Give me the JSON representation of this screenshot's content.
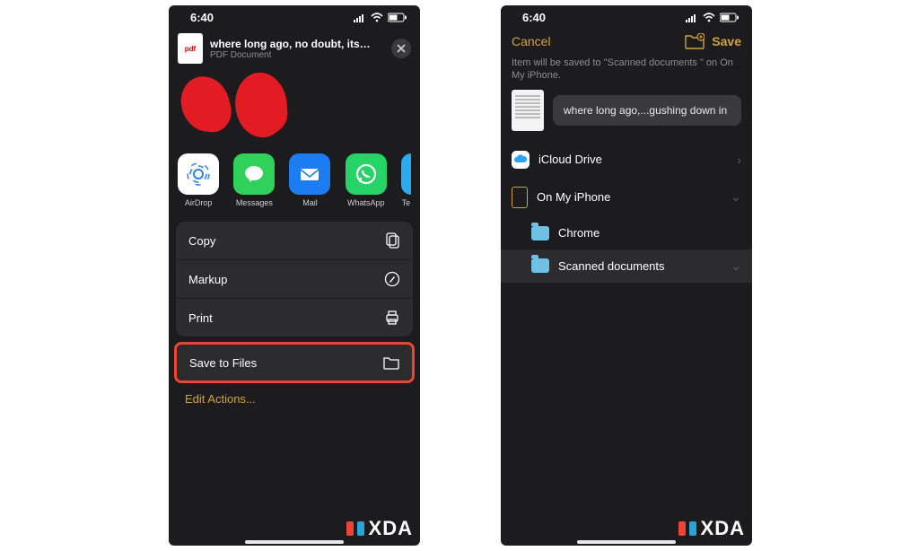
{
  "status_time": "6:40",
  "left": {
    "doc_title": "where long ago, no doubt, its sprin...",
    "doc_sub": "PDF Document",
    "doc_badge": "pdf",
    "apps": [
      {
        "id": "airdrop",
        "label": "AirDrop"
      },
      {
        "id": "messages",
        "label": "Messages"
      },
      {
        "id": "mail",
        "label": "Mail"
      },
      {
        "id": "whatsapp",
        "label": "WhatsApp"
      },
      {
        "id": "telegram",
        "label": "Te"
      }
    ],
    "actions": {
      "copy": "Copy",
      "markup": "Markup",
      "print": "Print",
      "save_files": "Save to Files"
    },
    "edit_actions": "Edit Actions..."
  },
  "right": {
    "cancel": "Cancel",
    "save": "Save",
    "note": "Item will be saved to \"Scanned documents \" on On My iPhone.",
    "file_name": "where long ago,...gushing down in",
    "locations": {
      "icloud": "iCloud Drive",
      "on_my_iphone": "On My iPhone",
      "chrome": "Chrome",
      "scanned": "Scanned documents"
    }
  },
  "watermark": "XDA"
}
